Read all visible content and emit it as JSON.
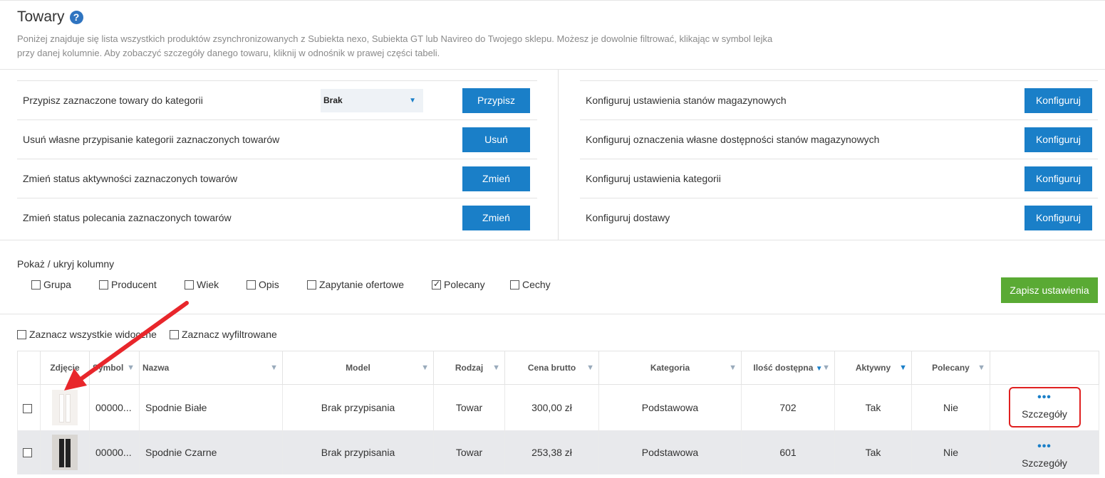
{
  "header": {
    "title": "Towary",
    "help_icon": "?",
    "description_line1": "Poniżej znajduje się lista wszystkich produktów zsynchronizowanych z Subiekta nexo, Subiekta GT lub Navireo do Twojego sklepu. Możesz je dowolnie filtrować, klikając w symbol lejka",
    "description_line2": "przy danej kolumnie. Aby zobaczyć szczegóły danego towaru, kliknij w odnośnik w prawej części tabeli."
  },
  "actions_left": [
    {
      "label": "Przypisz zaznaczone towary do kategorii",
      "button": "Przypisz",
      "select_value": "Brak"
    },
    {
      "label": "Usuń własne przypisanie kategorii zaznaczonych towarów",
      "button": "Usuń"
    },
    {
      "label": "Zmień status aktywności zaznaczonych towarów",
      "button": "Zmień"
    },
    {
      "label": "Zmień status polecania zaznaczonych towarów",
      "button": "Zmień"
    }
  ],
  "actions_right": [
    {
      "label": "Konfiguruj ustawienia stanów magazynowych",
      "button": "Konfiguruj"
    },
    {
      "label": "Konfiguruj oznaczenia własne dostępności stanów magazynowych",
      "button": "Konfiguruj"
    },
    {
      "label": "Konfiguruj ustawienia kategorii",
      "button": "Konfiguruj"
    },
    {
      "label": "Konfiguruj dostawy",
      "button": "Konfiguruj"
    }
  ],
  "columns_section": {
    "title": "Pokaż / ukryj kolumny",
    "items": [
      {
        "label": "Grupa",
        "checked": false
      },
      {
        "label": "Producent",
        "checked": false
      },
      {
        "label": "Wiek",
        "checked": false
      },
      {
        "label": "Opis",
        "checked": false
      },
      {
        "label": "Zapytanie ofertowe",
        "checked": false
      },
      {
        "label": "Polecany",
        "checked": true
      },
      {
        "label": "Cechy",
        "checked": false
      }
    ],
    "save_label": "Zapisz ustawienia"
  },
  "selectors": {
    "select_visible": "Zaznacz wszystkie widoczne",
    "select_filtered": "Zaznacz wyfiltrowane"
  },
  "table": {
    "headers": {
      "photo": "Zdjęcie",
      "symbol": "Symbol",
      "name": "Nazwa",
      "model": "Model",
      "type": "Rodzaj",
      "price": "Cena brutto",
      "category": "Kategoria",
      "qty": "Ilość dostępna",
      "qty_sort": "▼",
      "active": "Aktywny",
      "recommended": "Polecany"
    },
    "rows": [
      {
        "symbol": "00000...",
        "name": "Spodnie Białe",
        "model": "Brak przypisania",
        "type": "Towar",
        "price": "300,00 zł",
        "category": "Podstawowa",
        "qty": "702",
        "active": "Tak",
        "recommended": "Nie",
        "details": "Szczegóły",
        "dots": "•••",
        "photo_icon": "white-trousers-icon"
      },
      {
        "symbol": "00000...",
        "name": "Spodnie Czarne",
        "model": "Brak przypisania",
        "type": "Towar",
        "price": "253,38 zł",
        "category": "Podstawowa",
        "qty": "601",
        "active": "Tak",
        "recommended": "Nie",
        "details": "Szczegóły",
        "dots": "•••",
        "photo_icon": "black-trousers-icon"
      }
    ]
  },
  "colors": {
    "primary": "#1a7fc8",
    "save": "#5aaa34",
    "highlight": "#e02020",
    "arrow": "#e8262b"
  }
}
